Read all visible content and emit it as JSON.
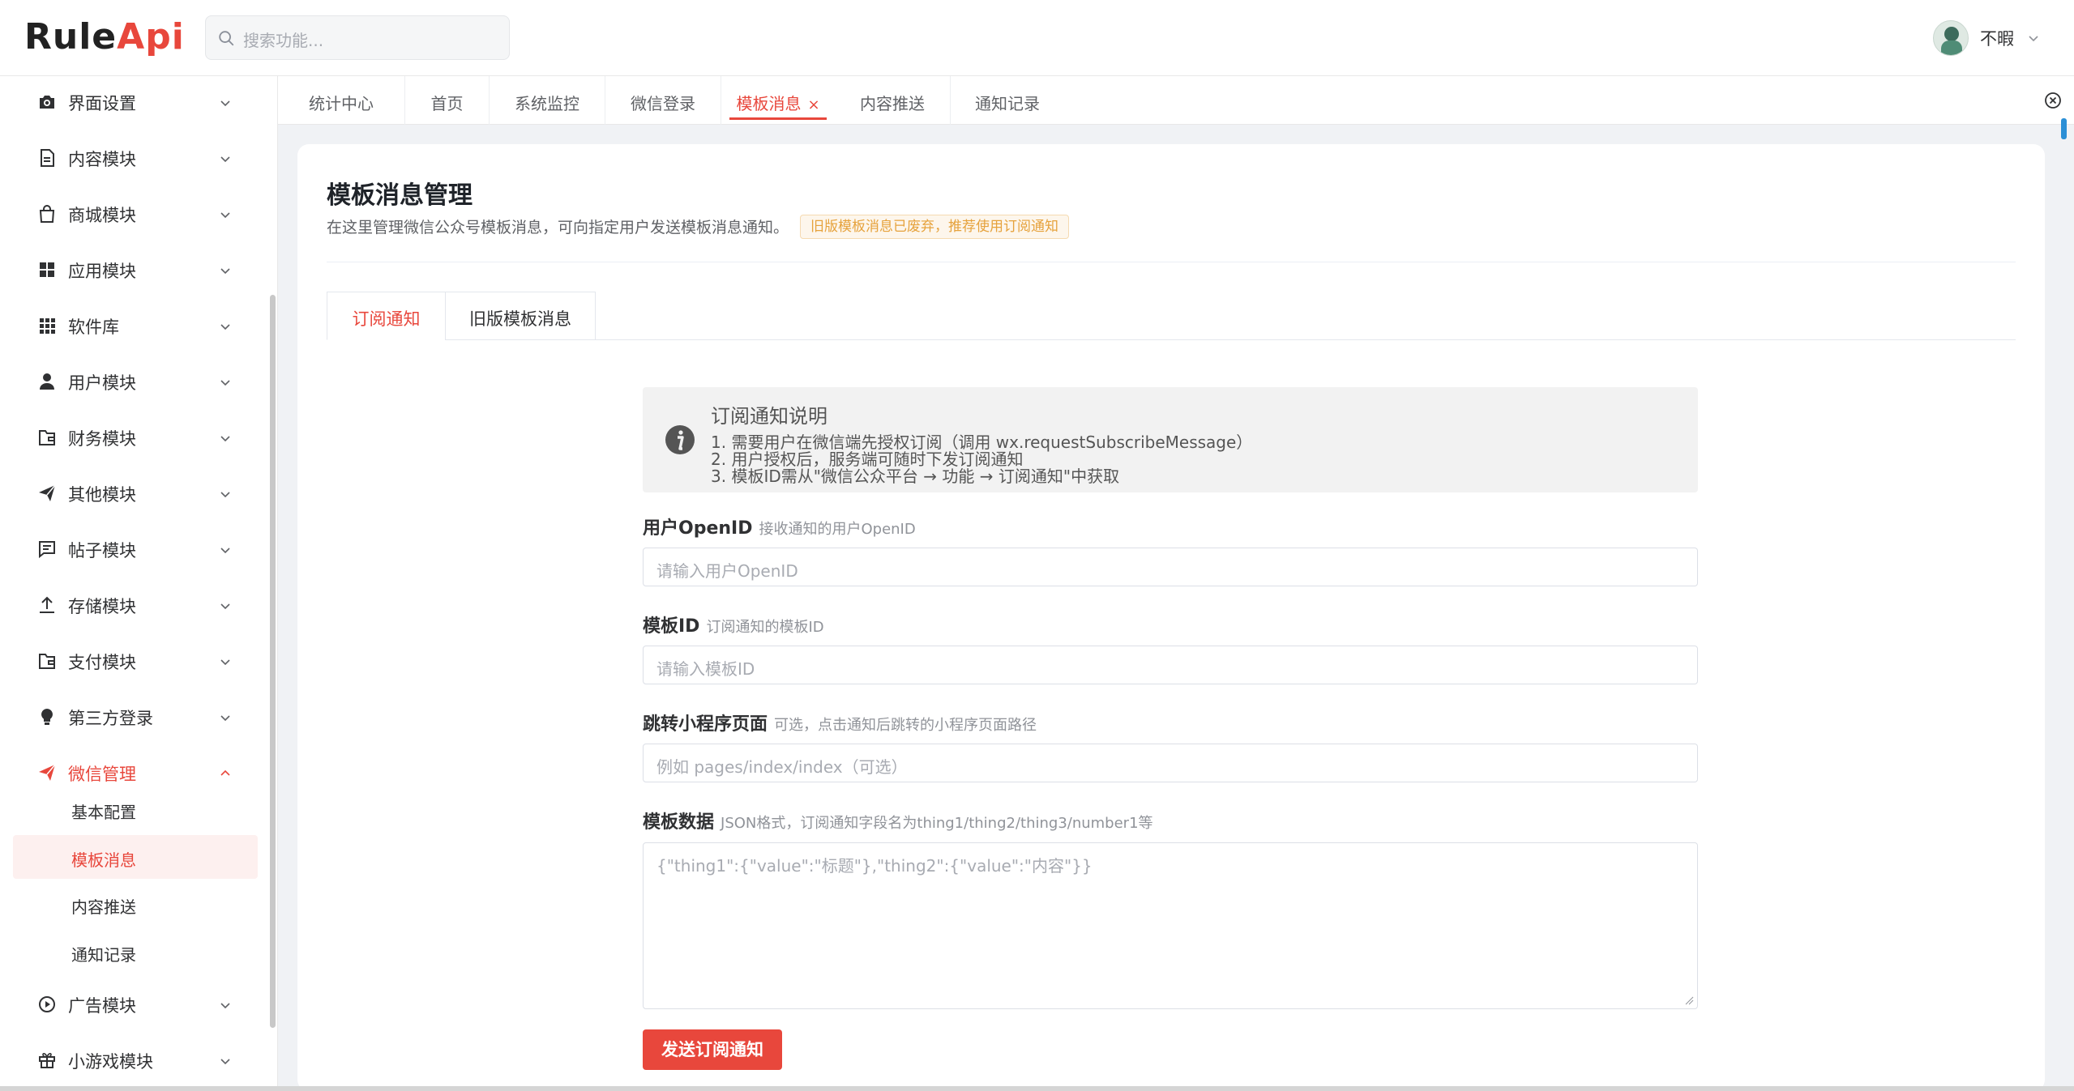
{
  "app": {
    "logo_part1": "Rule",
    "logo_part2": "Api"
  },
  "search": {
    "placeholder": "搜索功能..."
  },
  "user": {
    "name": "不暇"
  },
  "sidebar": {
    "items": [
      {
        "label": "界面设置",
        "icon": "camera-icon"
      },
      {
        "label": "内容模块",
        "icon": "document-icon"
      },
      {
        "label": "商城模块",
        "icon": "shopping-bag-icon"
      },
      {
        "label": "应用模块",
        "icon": "grid-icon"
      },
      {
        "label": "软件库",
        "icon": "apps-grid-icon"
      },
      {
        "label": "用户模块",
        "icon": "user-icon"
      },
      {
        "label": "财务模块",
        "icon": "wallet-icon"
      },
      {
        "label": "其他模块",
        "icon": "send-icon"
      },
      {
        "label": "帖子模块",
        "icon": "message-icon"
      },
      {
        "label": "存储模块",
        "icon": "upload-icon"
      },
      {
        "label": "支付模块",
        "icon": "wallet-icon"
      },
      {
        "label": "第三方登录",
        "icon": "bulb-icon"
      },
      {
        "label": "微信管理",
        "icon": "send-icon",
        "expanded": true
      },
      {
        "label": "广告模块",
        "icon": "play-circle-icon"
      },
      {
        "label": "小游戏模块",
        "icon": "gift-icon"
      }
    ],
    "wechat_sub": [
      {
        "label": "基本配置"
      },
      {
        "label": "模板消息",
        "active": true
      },
      {
        "label": "内容推送"
      },
      {
        "label": "通知记录"
      }
    ]
  },
  "page_tabs": [
    {
      "label": "统计中心"
    },
    {
      "label": "首页"
    },
    {
      "label": "系统监控"
    },
    {
      "label": "微信登录"
    },
    {
      "label": "模板消息",
      "active": true,
      "close": "×"
    },
    {
      "label": "内容推送"
    },
    {
      "label": "通知记录"
    }
  ],
  "main": {
    "title": "模板消息管理",
    "description": "在这里管理微信公众号模板消息，可向指定用户发送模板消息通知。",
    "deprecated_tag": "旧版模板消息已废弃，推荐使用订阅通知",
    "tabs": [
      {
        "label": "订阅通知",
        "active": true
      },
      {
        "label": "旧版模板消息"
      }
    ],
    "info": {
      "title": "订阅通知说明",
      "lines": [
        "1. 需要用户在微信端先授权订阅（调用 wx.requestSubscribeMessage）",
        "2. 用户授权后，服务端可随时下发订阅通知",
        "3. 模板ID需从\"微信公众平台 → 功能 → 订阅通知\"中获取"
      ]
    },
    "fields": {
      "openid": {
        "label": "用户OpenID",
        "hint": "接收通知的用户OpenID",
        "placeholder": "请输入用户OpenID"
      },
      "template_id": {
        "label": "模板ID",
        "hint": "订阅通知的模板ID",
        "placeholder": "请输入模板ID"
      },
      "page": {
        "label": "跳转小程序页面",
        "hint": "可选，点击通知后跳转的小程序页面路径",
        "placeholder": "例如 pages/index/index（可选）"
      },
      "data": {
        "label": "模板数据",
        "hint": "JSON格式，订阅通知字段名为thing1/thing2/thing3/number1等",
        "placeholder": "{\"thing1\":{\"value\":\"标题\"},\"thing2\":{\"value\":\"内容\"}}"
      }
    },
    "submit_label": "发送订阅通知"
  },
  "colors": {
    "accent": "#e8473c",
    "warning": "#e6a23c"
  }
}
